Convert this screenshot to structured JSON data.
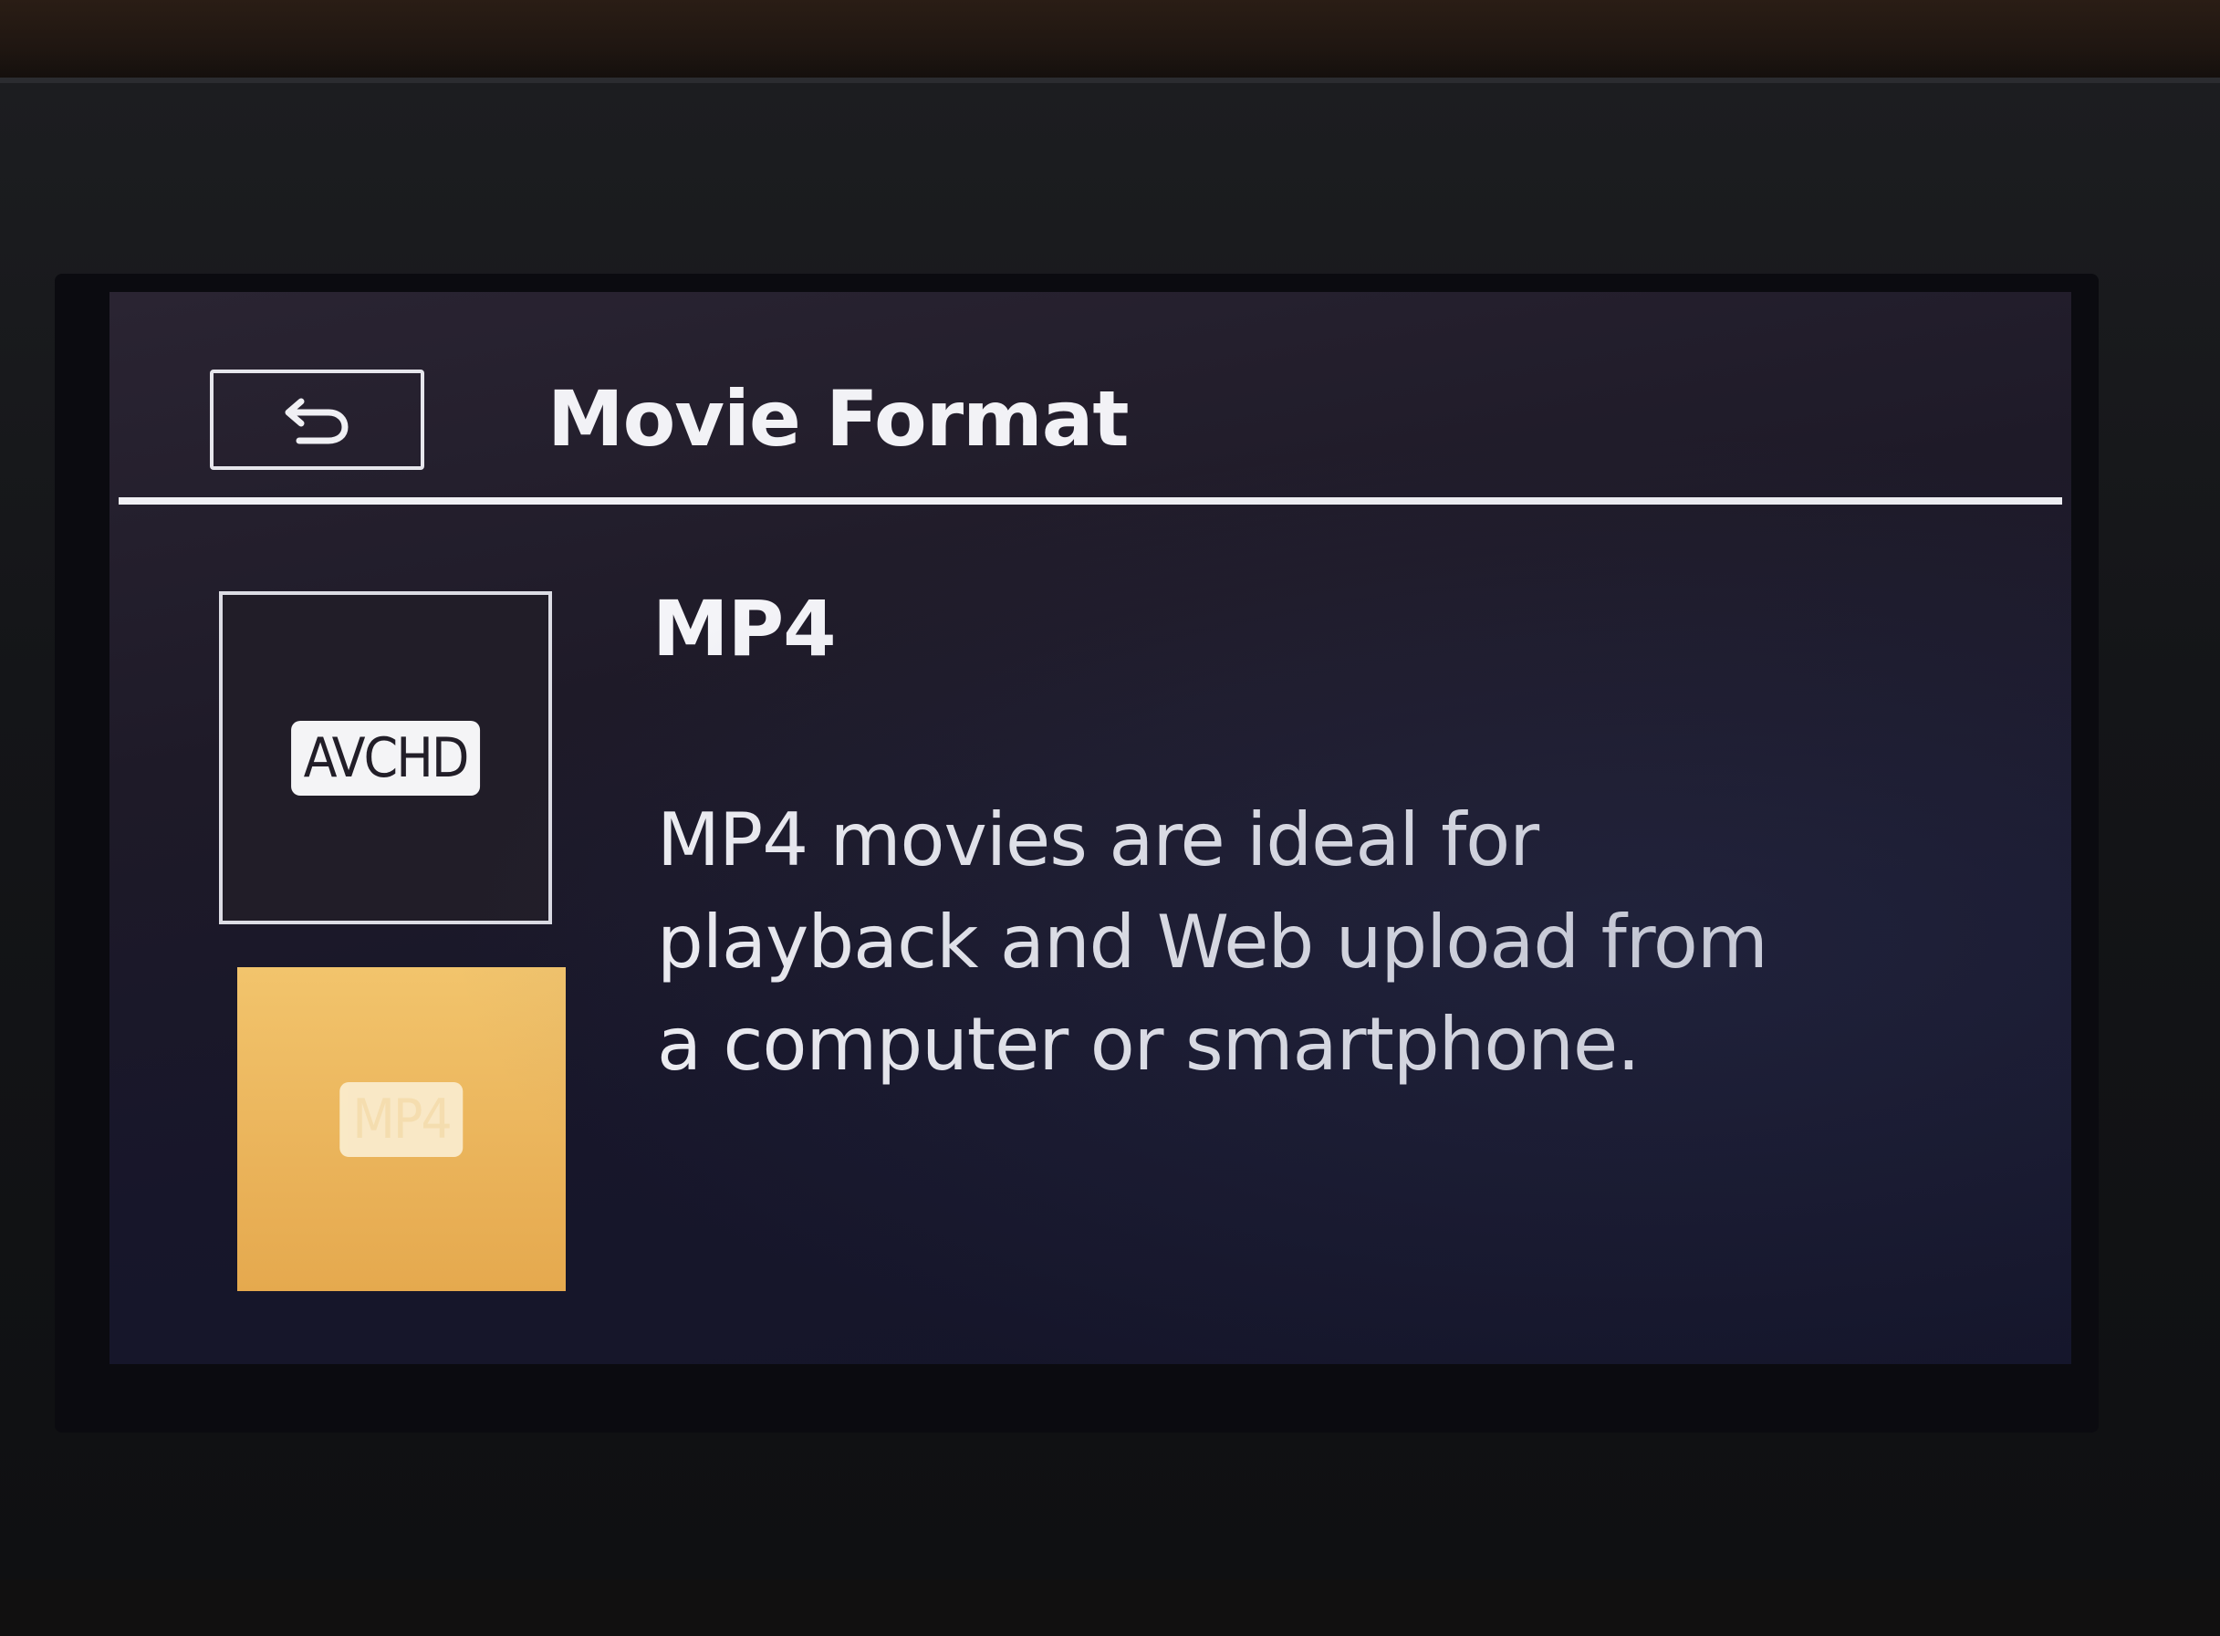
{
  "screen": {
    "title": "Movie Format",
    "back_icon": "return-arrow-icon"
  },
  "options": [
    {
      "label": "AVCHD",
      "selected": false
    },
    {
      "label": "MP4",
      "selected": true
    }
  ],
  "detail": {
    "name": "MP4",
    "description_lines": [
      "MP4 movies are ideal for",
      "playback and Web upload from",
      "a computer or smartphone."
    ]
  },
  "colors": {
    "screen_background": "#1e1a28",
    "selected_tile": "#eab35a",
    "text": "#f2f2f6"
  }
}
